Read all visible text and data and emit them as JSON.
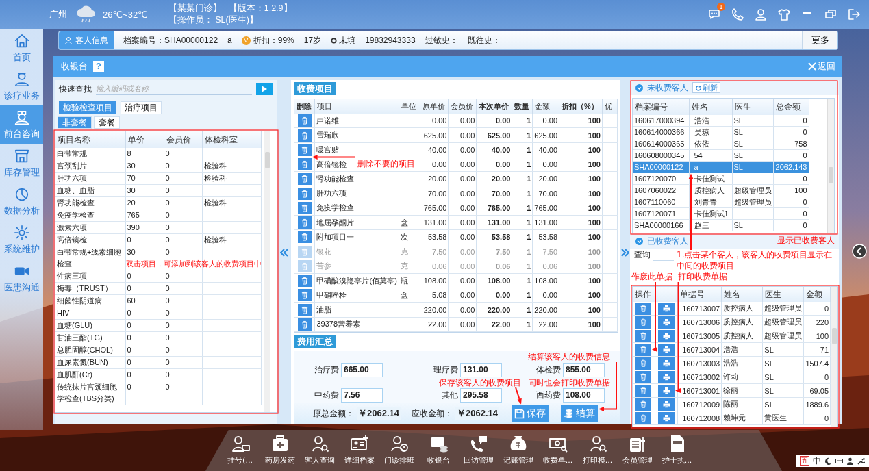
{
  "header": {
    "city": "广州",
    "temperature": "26℃~32℃",
    "clinic": "【某某门诊】",
    "version": "【版本：1.2.9】",
    "operator": "【操作员： SL(医生)】",
    "notification_count": "1"
  },
  "nav": [
    {
      "label": "首页",
      "selected": false
    },
    {
      "label": "诊疗业务",
      "selected": false
    },
    {
      "label": "前台咨询",
      "selected": true
    },
    {
      "label": "库存管理",
      "selected": false
    },
    {
      "label": "数据分析",
      "selected": false
    },
    {
      "label": "系统维护",
      "selected": false
    },
    {
      "label": "医患沟通",
      "selected": false
    }
  ],
  "customer_bar": {
    "button": "客人信息",
    "record_no": "档案编号：SHA00000122",
    "name": "a",
    "vip_badge": "V",
    "discount": "折扣：99%",
    "age": "17岁",
    "gender": "未填",
    "phone": "19832943333",
    "allergy": "过敏史：",
    "history": "既往史：",
    "more": "更多"
  },
  "cashier": {
    "title": "收银台",
    "help": "?",
    "back": "返回"
  },
  "search": {
    "label": "快速查找",
    "placeholder": "输入编码或名称"
  },
  "item_tabs": [
    {
      "label": "检验检查项目",
      "selected": true
    },
    {
      "label": "治疗项目",
      "selected": false
    }
  ],
  "package_tabs": [
    {
      "label": "非套餐",
      "selected": true
    },
    {
      "label": "套餐",
      "selected": false
    }
  ],
  "items_table": {
    "columns": [
      "项目名称",
      "单价",
      "会员价",
      "体检科室"
    ],
    "rows": [
      {
        "name": "白带常规",
        "price": "8",
        "member_price": "0"
      },
      {
        "name": "宫颈刮片",
        "price": "30",
        "member_price": "0",
        "department": "检验科"
      },
      {
        "name": "肝功六项",
        "price": "70",
        "member_price": "0",
        "department": "检验科"
      },
      {
        "name": "血糖、血脂",
        "price": "30",
        "member_price": "0"
      },
      {
        "name": "肾功能检查",
        "price": "20",
        "member_price": "0",
        "department": "检验科"
      },
      {
        "name": "免疫学检查",
        "price": "765",
        "member_price": "0"
      },
      {
        "name": "激素六项",
        "price": "390",
        "member_price": "0"
      },
      {
        "name": "高倍镜检",
        "price": "0",
        "member_price": "0",
        "department": "检验科"
      },
      {
        "name": "白带常规+线索细胞检查",
        "price": "30",
        "member_price": "0"
      },
      {
        "name": "性病三项",
        "price": "0",
        "member_price": "0"
      },
      {
        "name": "梅毒（TRUST）",
        "price": "0",
        "member_price": "0"
      },
      {
        "name": "细菌性阴道病",
        "price": "60",
        "member_price": "0"
      },
      {
        "name": "HIV",
        "price": "0",
        "member_price": "0"
      },
      {
        "name": "血糖(GLU)",
        "price": "0",
        "member_price": "0"
      },
      {
        "name": "甘油三酯(TG)",
        "price": "0",
        "member_price": "0"
      },
      {
        "name": "总胆固醇(CHOL)",
        "price": "0",
        "member_price": "0"
      },
      {
        "name": "血尿素氮(BUN)",
        "price": "0",
        "member_price": "0"
      },
      {
        "name": "血肌酐(Cr)",
        "price": "0",
        "member_price": "0"
      },
      {
        "name": "传统抹片宫颈细胞学检查(TBS分类)",
        "price": "0",
        "member_price": "0"
      }
    ]
  },
  "charges": {
    "title": "收费项目",
    "columns": [
      "删除",
      "项目",
      "单位",
      "原单价",
      "会员价",
      "本次单价",
      "数量",
      "金额",
      "折扣（%）",
      "优"
    ],
    "rows": [
      {
        "item": "声诺维",
        "price": "0.00",
        "member_price": "0.00",
        "current_price": "0.00",
        "qty": "1",
        "amount": "0.00",
        "discount": "100",
        "disabled": false
      },
      {
        "item": "雪瑞欣",
        "price": "625.00",
        "member_price": "0.00",
        "current_price": "625.00",
        "qty": "1",
        "amount": "625.00",
        "discount": "100",
        "disabled": false
      },
      {
        "item": "暖宫贴",
        "price": "40.00",
        "member_price": "0.00",
        "current_price": "40.00",
        "qty": "1",
        "amount": "40.00",
        "discount": "100",
        "disabled": false
      },
      {
        "item": "高倍镜检",
        "price": "0.00",
        "member_price": "0.00",
        "current_price": "0.00",
        "qty": "1",
        "amount": "0.00",
        "discount": "100",
        "disabled": false
      },
      {
        "item": "肾功能检查",
        "price": "20.00",
        "member_price": "0.00",
        "current_price": "20.00",
        "qty": "1",
        "amount": "20.00",
        "discount": "100",
        "disabled": false
      },
      {
        "item": "肝功六项",
        "price": "70.00",
        "member_price": "0.00",
        "current_price": "70.00",
        "qty": "1",
        "amount": "70.00",
        "discount": "100",
        "disabled": false
      },
      {
        "item": "免疫学检查",
        "price": "765.00",
        "member_price": "0.00",
        "current_price": "765.00",
        "qty": "1",
        "amount": "765.00",
        "discount": "100",
        "disabled": false
      },
      {
        "item": "地屈孕酮片",
        "unit": "盒",
        "price": "131.00",
        "member_price": "0.00",
        "current_price": "131.00",
        "qty": "1",
        "amount": "131.00",
        "discount": "100",
        "disabled": false
      },
      {
        "item": "附加项目一",
        "unit": "次",
        "price": "53.58",
        "member_price": "0.00",
        "current_price": "53.58",
        "qty": "1",
        "amount": "53.58",
        "discount": "100",
        "disabled": false
      },
      {
        "item": "银花",
        "unit": "克",
        "price": "7.50",
        "member_price": "0.00",
        "current_price": "7.50",
        "qty": "1",
        "amount": "7.50",
        "discount": "100",
        "disabled": true
      },
      {
        "item": "苦参",
        "unit": "克",
        "price": "0.06",
        "member_price": "0.00",
        "current_price": "0.06",
        "qty": "1",
        "amount": "0.06",
        "discount": "100",
        "disabled": true
      },
      {
        "item": "甲磺酸溴隐亭片(佰莫亭)",
        "unit": "瓶",
        "price": "108.00",
        "member_price": "0.00",
        "current_price": "108.00",
        "qty": "1",
        "amount": "108.00",
        "discount": "100",
        "disabled": false
      },
      {
        "item": "甲硝唑栓",
        "unit": "盒",
        "price": "5.08",
        "member_price": "0.00",
        "current_price": "0.00",
        "qty": "1",
        "amount": "0.00",
        "discount": "100",
        "disabled": false
      },
      {
        "item": "油脂",
        "price": "220.00",
        "member_price": "0.00",
        "current_price": "220.00",
        "qty": "1",
        "amount": "220.00",
        "discount": "100",
        "disabled": false
      },
      {
        "item": "39378营养素",
        "price": "22.00",
        "member_price": "0.00",
        "current_price": "22.00",
        "qty": "1",
        "amount": "22.00",
        "discount": "100",
        "disabled": false
      }
    ]
  },
  "summary": {
    "title": "费用汇总",
    "fees": [
      {
        "label": "治疗费",
        "value": "665.00"
      },
      {
        "label": "理疗费",
        "value": "131.00"
      },
      {
        "label": "体检费",
        "value": "855.00"
      },
      {
        "label": "中药费",
        "value": "7.56"
      },
      {
        "label": "其他",
        "value": "295.58"
      },
      {
        "label": "西药费",
        "value": "108.00"
      }
    ],
    "original_total_label": "原总金额：",
    "original_total": "￥2062.14",
    "receivable_label": "应收金额：",
    "receivable": "￥2062.14",
    "save": "保存",
    "settle": "结算"
  },
  "unpaid": {
    "title": "未收费客人",
    "refresh": "刷新",
    "columns": [
      "档案编号",
      "姓名",
      "医生",
      "总金额"
    ],
    "rows": [
      {
        "record_no": "160617000394",
        "name": "浩浩",
        "doctor": "SL",
        "total": "0",
        "selected": false
      },
      {
        "record_no": "160614000366",
        "name": "吴琼",
        "doctor": "SL",
        "total": "0",
        "selected": false
      },
      {
        "record_no": "160614000365",
        "name": "依依",
        "doctor": "SL",
        "total": "758",
        "selected": false
      },
      {
        "record_no": "160608000345",
        "name": "54",
        "doctor": "SL",
        "total": "0",
        "selected": false
      },
      {
        "record_no": "SHA00000122",
        "name": "a",
        "doctor": "SL",
        "total": "2062.143",
        "selected": true
      },
      {
        "record_no": "1607120070",
        "name": "卡佳测试",
        "total": "0",
        "selected": false
      },
      {
        "record_no": "1607060022",
        "name": "质控病人",
        "doctor": "超级管理员",
        "total": "100",
        "selected": false
      },
      {
        "record_no": "1607110060",
        "name": "刘青青",
        "doctor": "超级管理员",
        "total": "0",
        "selected": false
      },
      {
        "record_no": "1607120071",
        "name": "卡佳测试1",
        "total": "0",
        "selected": false
      },
      {
        "record_no": "SHA00000166",
        "name": "赵三",
        "doctor": "SL",
        "total": "0",
        "selected": false
      }
    ]
  },
  "paid": {
    "title": "已收费客人",
    "query_label": "查询",
    "columns": [
      "操作",
      "单据号",
      "姓名",
      "医生",
      "金额"
    ],
    "rows": [
      {
        "receipt_no": "160713007",
        "name": "质控病人",
        "doctor": "超级管理员",
        "amount": "0"
      },
      {
        "receipt_no": "160713006",
        "name": "质控病人",
        "doctor": "超级管理员",
        "amount": "220"
      },
      {
        "receipt_no": "160713005",
        "name": "质控病人",
        "doctor": "超级管理员",
        "amount": "100"
      },
      {
        "receipt_no": "160713004",
        "name": "浩浩",
        "doctor": "SL",
        "amount": "71"
      },
      {
        "receipt_no": "160713003",
        "name": "浩浩",
        "doctor": "SL",
        "amount": "1507.4"
      },
      {
        "receipt_no": "160713002",
        "name": "许莉",
        "doctor": "SL",
        "amount": "0"
      },
      {
        "receipt_no": "160713001",
        "name": "徐丽",
        "doctor": "SL",
        "amount": "69.05"
      },
      {
        "receipt_no": "160712009",
        "name": "陈丽",
        "doctor": "SL",
        "amount": "1889.6"
      },
      {
        "receipt_no": "160712008",
        "name": "赖坤元",
        "doctor": "黄医生",
        "amount": "0"
      }
    ]
  },
  "annotations": [
    {
      "text": "删除不要的项目"
    },
    {
      "text": "显示已收费客人"
    },
    {
      "text": "双击项目，可添加到该客人的收费项目中"
    },
    {
      "text": "1.点击某个客人，该客人的收费项目显示在中间的收费项目"
    },
    {
      "text": "作废此单据"
    },
    {
      "text": "打印收费单据"
    },
    {
      "text": "结算该客人的收费信息"
    },
    {
      "text": "保存该客人的收费项目"
    },
    {
      "text": "同时也会打印收费单据"
    }
  ],
  "dock": [
    {
      "label": "挂号(..."
    },
    {
      "label": "药房发药"
    },
    {
      "label": "客人查询"
    },
    {
      "label": "详细档案"
    },
    {
      "label": "门诊排班"
    },
    {
      "label": "收银台"
    },
    {
      "label": "回访管理"
    },
    {
      "label": "记账管理"
    },
    {
      "label": "收费单..."
    },
    {
      "label": "打印模..."
    },
    {
      "label": "会员管理"
    },
    {
      "label": "护士执..."
    }
  ],
  "tray": {
    "input_mode": "五",
    "language": "中"
  }
}
